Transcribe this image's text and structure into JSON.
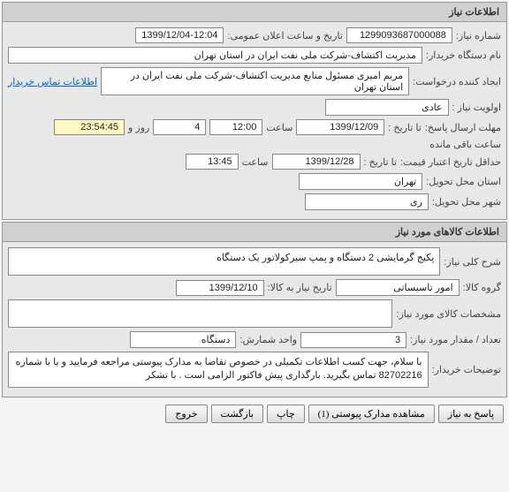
{
  "panel1": {
    "title": "اطلاعات نیاز",
    "labels": {
      "need_no": "شماره نیاز:",
      "announce_time": "تاریخ و ساعت اعلان عمومی:",
      "buyer_org": "نام دستگاه خریدار:",
      "requester": "ایجاد کننده درخواست:",
      "priority": "اولویت نیاز :",
      "deadline": "مهلت ارسال پاسخ:",
      "until_date": "تا تاریخ :",
      "time": "ساعت",
      "days_and": "روز و",
      "remaining": "ساعت باقی مانده",
      "min_validity": "حداقل تاریخ اعتبار قیمت:",
      "delivery_province": "استان محل تحویل:",
      "delivery_city": "شهر محل تحویل:",
      "contact_link": "اطلاعات تماس خریدار"
    },
    "values": {
      "need_no": "1299093687000088",
      "announce_date": "1399/12/04",
      "announce_time": "12:04",
      "buyer_org": "مدیریت اکتشاف-شرکت ملی نفت ایران در استان تهران",
      "requester": "مریم امیری مسئول منابع مدیریت اکتشاف-شرکت ملی نفت ایران در استان تهران",
      "priority": "عادی",
      "deadline_date": "1399/12/09",
      "deadline_time": "12:00",
      "remaining_days": "4",
      "remaining_time": "23:54:45",
      "validity_date": "1399/12/28",
      "validity_time": "13:45",
      "province": "تهران",
      "city": "ری"
    }
  },
  "panel2": {
    "title": "اطلاعات کالاهای مورد نیاز",
    "labels": {
      "general_desc": "شرح کلی نیاز:",
      "goods_group": "گروه کالا:",
      "need_by_date": "تاریخ نیاز به کالا:",
      "specs": "مشخصات کالای مورد نیاز:",
      "qty": "تعداد / مقدار مورد نیاز:",
      "unit": "واحد شمارش:",
      "buyer_notes": "توضیحات خریدار:"
    },
    "values": {
      "general_desc": "پکیج گرمایشی 2 دستگاه و پمپ سیرکولاتور یک دستگاه",
      "goods_group": "امور تاسیساتی",
      "need_by_date": "1399/12/10",
      "specs": "",
      "qty": "3",
      "unit": "دستگاه",
      "buyer_notes": "با سلام، جهت کسب اطلاعات تکمیلی در خصوص تقاضا به مدارک پیوستی مراجعه فرمایید و یا با شماره 82702216 تماس بگیرید. بارگذاری پیش فاکتور الزامی است . با تشکر"
    }
  },
  "buttons": {
    "reply": "پاسخ به نیاز",
    "attachments": "مشاهده مدارک پیوستی   (1)",
    "print": "چاپ",
    "back": "بازگشت",
    "exit": "خروج"
  }
}
